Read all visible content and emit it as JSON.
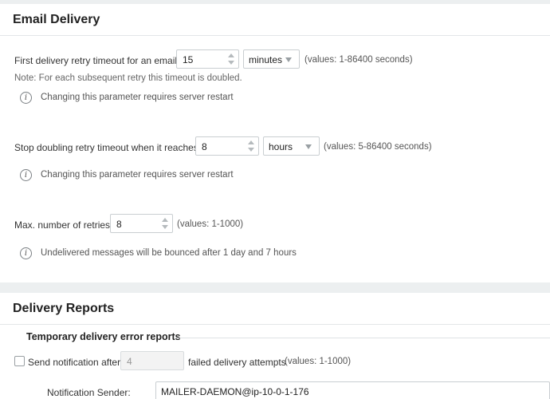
{
  "email_delivery": {
    "title": "Email Delivery",
    "first_retry": {
      "label": "First delivery retry timeout for an email:",
      "value": "15",
      "unit": "minutes",
      "hint": "(values: 1-86400 seconds)",
      "note": "Note: For each subsequent retry this timeout is doubled.",
      "info": "Changing this parameter requires server restart"
    },
    "stop_doubling": {
      "label": "Stop doubling retry timeout when it reaches:",
      "value": "8",
      "unit": "hours",
      "hint": "(values: 5-86400 seconds)",
      "info": "Changing this parameter requires server restart"
    },
    "max_retries": {
      "label": "Max. number of retries:",
      "value": "8",
      "hint": "(values: 1-1000)",
      "info": "Undelivered messages will be bounced after 1 day and 7 hours"
    }
  },
  "delivery_reports": {
    "title": "Delivery Reports",
    "temp_errors": {
      "title": "Temporary delivery error reports",
      "checkbox_label": "Send notification after",
      "attempts_value": "4",
      "attempts_suffix": "failed delivery attempts",
      "attempts_hint": "(values: 1-1000)",
      "checked": false
    },
    "sender": {
      "label": "Notification Sender:",
      "value": "MAILER-DAEMON@ip-10-0-1-176"
    }
  },
  "colors": {
    "page_bg": "#eceff0",
    "panel_bg": "#ffffff",
    "border": "#c9ced1"
  }
}
